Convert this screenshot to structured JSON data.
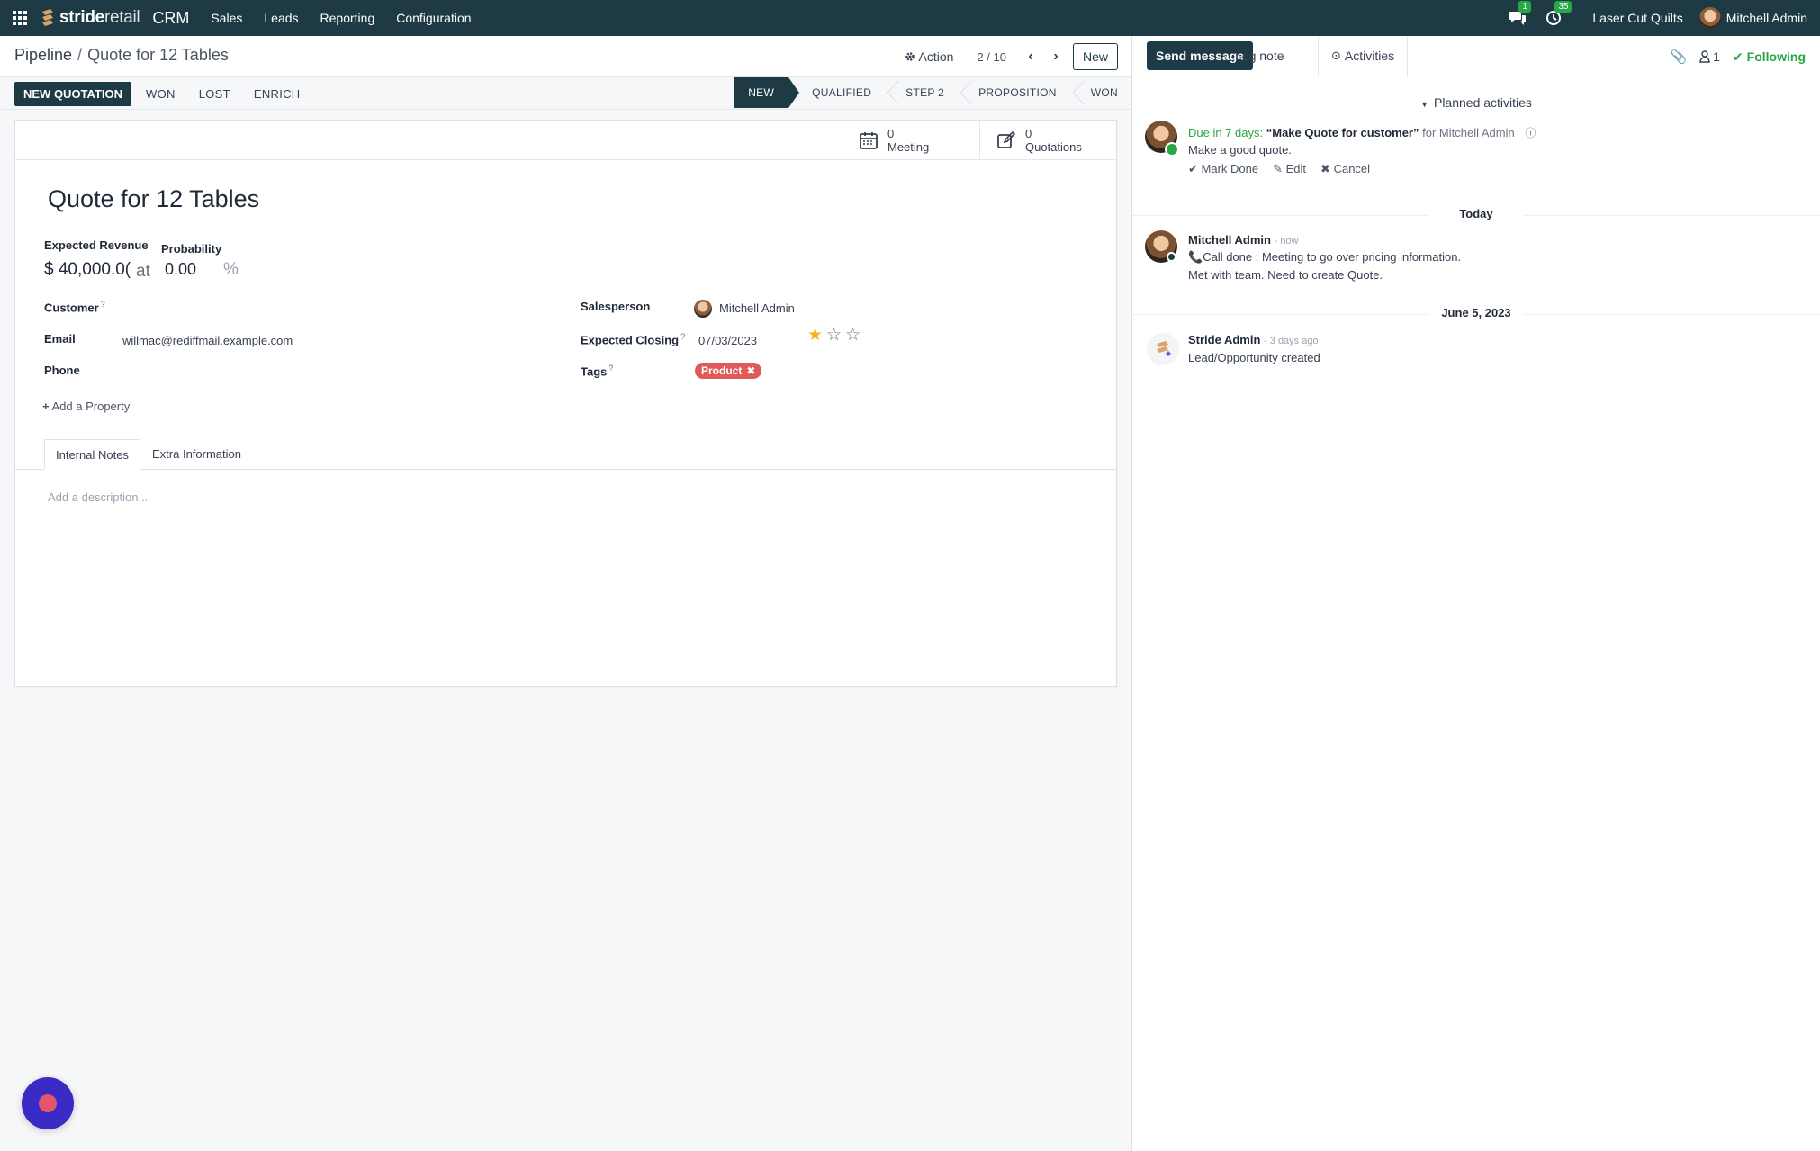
{
  "navbar": {
    "brand_bold": "stride",
    "brand_light": "retail",
    "app": "CRM",
    "menus": [
      "Sales",
      "Leads",
      "Reporting",
      "Configuration"
    ],
    "messages_count": "1",
    "activities_count": "35",
    "company": "Laser Cut Quilts",
    "user": "Mitchell Admin"
  },
  "control_panel": {
    "breadcrumb_root": "Pipeline",
    "breadcrumb_sep": "/",
    "breadcrumb_current": "Quote for 12 Tables",
    "action_label": "Action",
    "pager": "2 / 10",
    "new_label": "New"
  },
  "statusbar": {
    "new_quotation": "NEW QUOTATION",
    "won": "WON",
    "lost": "LOST",
    "enrich": "ENRICH",
    "stages": [
      "NEW",
      "QUALIFIED",
      "STEP 2",
      "PROPOSITION",
      "WON"
    ],
    "active_stage": "NEW"
  },
  "smart_buttons": {
    "meeting_count": "0",
    "meeting_label": "Meeting",
    "quotations_count": "0",
    "quotations_label": "Quotations"
  },
  "form": {
    "title": "Quote for 12 Tables",
    "expected_revenue_label": "Expected Revenue",
    "expected_revenue_value": "$ 40,000.0(",
    "at_label": "at",
    "probability_label": "Probability",
    "probability_value": "0.00",
    "percent": "%",
    "customer_label": "Customer",
    "email_label": "Email",
    "email_value": "willmac@rediffmail.example.com",
    "phone_label": "Phone",
    "salesperson_label": "Salesperson",
    "salesperson_value": "Mitchell Admin",
    "expected_closing_label": "Expected Closing",
    "expected_closing_value": "07/03/2023",
    "priority_stars": 1,
    "priority_max": 3,
    "tags_label": "Tags",
    "tag": "Product",
    "help_mark": "?",
    "add_property": "Add a Property",
    "tabs": [
      "Internal Notes",
      "Extra Information"
    ],
    "description_placeholder": "Add a description..."
  },
  "chatter": {
    "send_message": "Send message",
    "log_note": "Log note",
    "activities": "Activities",
    "followers_count": "1",
    "following": "Following",
    "planned_activities": "Planned activities",
    "activity": {
      "due": "Due in 7 days:",
      "name": "“Make Quote for customer”",
      "for": "for Mitchell Admin",
      "note": "Make a good quote.",
      "mark_done": "Mark Done",
      "edit": "Edit",
      "cancel": "Cancel"
    },
    "sep_today": "Today",
    "msg1": {
      "author": "Mitchell Admin",
      "time": "- now",
      "line1": "Call done : Meeting to go over pricing information.",
      "line2": "Met with team. Need to create Quote."
    },
    "sep_date": "June 5, 2023",
    "msg2": {
      "author": "Stride Admin",
      "time": "- 3 days ago",
      "line1": "Lead/Opportunity created"
    }
  }
}
